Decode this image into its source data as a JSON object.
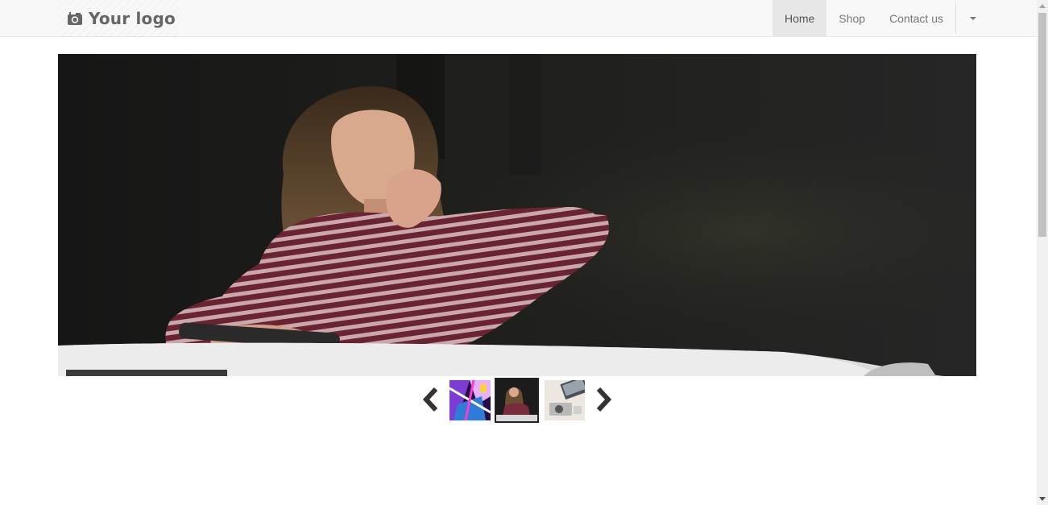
{
  "navbar": {
    "brand": {
      "text": "Your logo",
      "icon": "camera-icon"
    },
    "items": [
      {
        "label": "Home",
        "active": true
      },
      {
        "label": "Shop",
        "active": false
      },
      {
        "label": "Contact us",
        "active": false
      }
    ],
    "dropdown_icon": "caret-down-icon"
  },
  "carousel": {
    "active_index": 1,
    "thumbnails": [
      {
        "subject": "colorful abstract neon art"
      },
      {
        "subject": "woman at table with phone"
      },
      {
        "subject": "laptop and camera on desk"
      }
    ],
    "prev_icon": "chevron-left-icon",
    "next_icon": "chevron-right-icon"
  },
  "colors": {
    "navbar_bg": "#f8f8f8",
    "nav_active_bg": "#e7e7e7",
    "nav_text": "#777777",
    "active_thumb_border": "#222222",
    "arrow": "#333333"
  }
}
